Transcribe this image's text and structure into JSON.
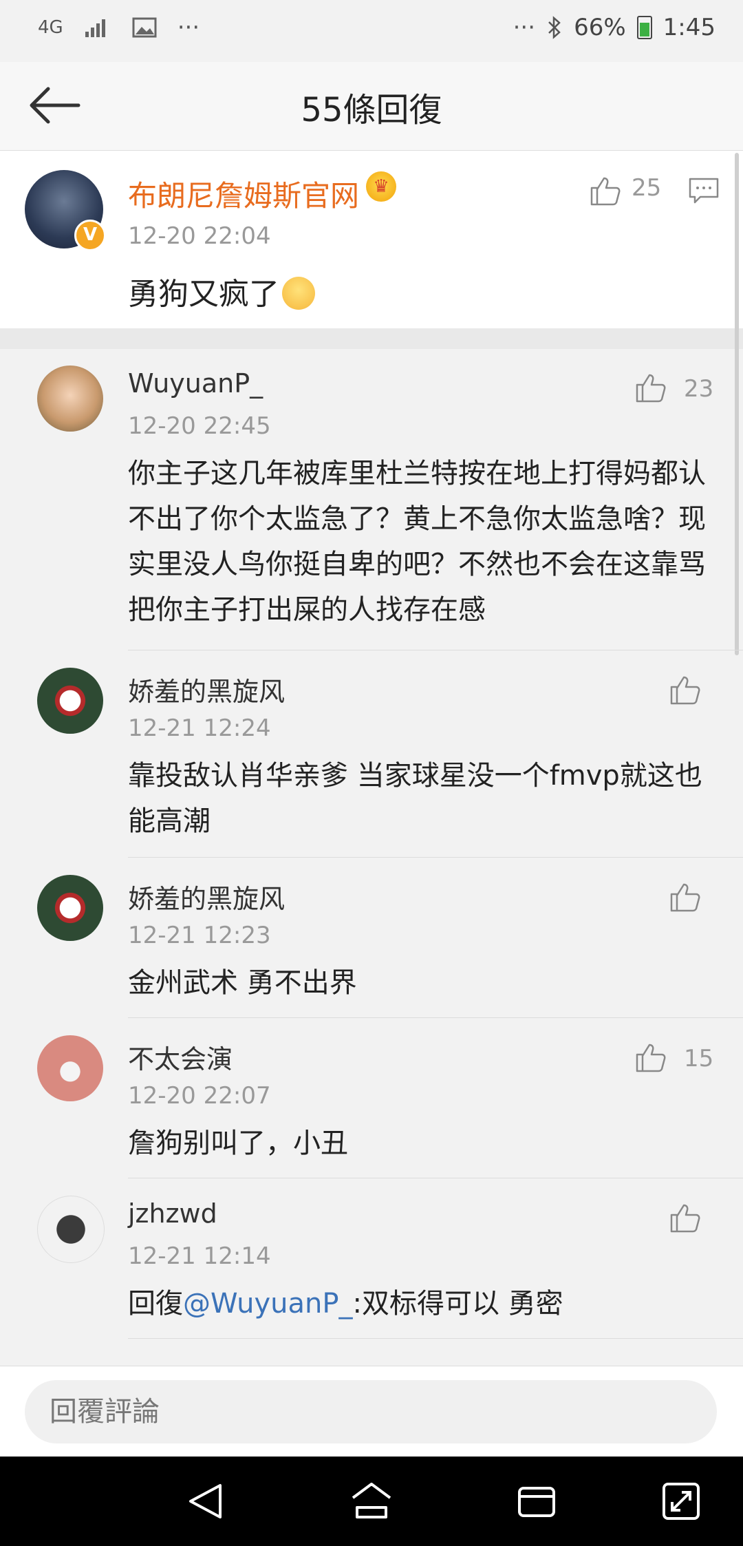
{
  "status_bar": {
    "network": "4G",
    "more": "···",
    "more_right": "···",
    "battery": "66%",
    "time": "1:45"
  },
  "header": {
    "title": "55條回復"
  },
  "main_post": {
    "author": "布朗尼詹姆斯官网",
    "time": "12-20 22:04",
    "text": "勇狗又疯了",
    "likes": "25"
  },
  "replies": [
    {
      "author": "WuyuanP_",
      "time": "12-20 22:45",
      "text": "你主子这几年被库里杜兰特按在地上打得妈都认不出了你个太监急了？黄上不急你太监急啥？现实里没人鸟你挺自卑的吧？不然也不会在这靠骂把你主子打出屎的人找存在感",
      "likes": "23"
    },
    {
      "author": "娇羞的黑旋风",
      "time": "12-21 12:24",
      "text": "靠投敌认肖华亲爹  当家球星没一个fmvp就这也能高潮",
      "likes": ""
    },
    {
      "author": "娇羞的黑旋风",
      "time": "12-21 12:23",
      "text": "金州武术  勇不出界",
      "likes": ""
    },
    {
      "author": "不太会演",
      "time": "12-20 22:07",
      "text": "詹狗别叫了，小丑",
      "likes": "15"
    },
    {
      "author": "jzhzwd",
      "time": "12-21 12:14",
      "text_prefix": "回復",
      "mention": "@WuyuanP_",
      "text_suffix": ":双标得可以  勇密",
      "likes": ""
    }
  ],
  "input": {
    "placeholder": "回覆評論"
  },
  "colors": {
    "vip_name": "#e86c1f",
    "mention": "#3b72b8"
  }
}
